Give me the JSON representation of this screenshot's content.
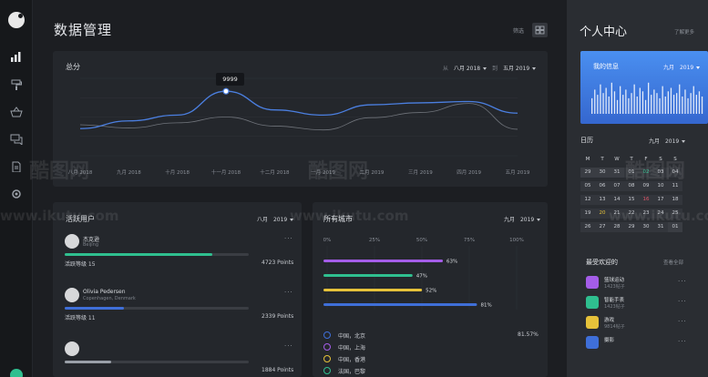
{
  "nav": {
    "icons": [
      "bar-chart-icon",
      "paint-roller-icon",
      "basket-icon",
      "chat-icon",
      "document-icon",
      "settings-icon"
    ]
  },
  "header": {
    "title": "数据管理",
    "filter_label": "筛选"
  },
  "total_score": {
    "title": "总分",
    "from_label": "从",
    "from_month": "八月 2018",
    "to_label": "到",
    "to_month": "五月 2019",
    "tooltip_value": "9999",
    "chart_data": {
      "type": "line",
      "categories": [
        "八月 2018",
        "九月 2018",
        "十月 2018",
        "十一月 2018",
        "十二月 2018",
        "一月 2019",
        "二月 2019",
        "三月 2019",
        "四月 2019",
        "五月 2019"
      ],
      "series": [
        {
          "values": [
            4200,
            5400,
            6300,
            9999,
            7100,
            6300,
            7900,
            8200,
            8400,
            6600
          ],
          "color": "#4b7fe0"
        },
        {
          "values": [
            4800,
            4300,
            5100,
            6000,
            4600,
            4000,
            5900,
            6700,
            8100,
            4100
          ],
          "color": "#6f737a"
        }
      ],
      "grid": true
    }
  },
  "active_users": {
    "title": "活跃用户",
    "month": "八月",
    "year": "2019",
    "users": [
      {
        "name": "杰克逊",
        "location": "Beijing",
        "level_label": "活跃等级 15",
        "points": "4723 Points",
        "progress": 0.8,
        "color": "#2fbf8f"
      },
      {
        "name": "Olivia Pedersen",
        "location": "Copenhagen, Denmark",
        "level_label": "活跃等级 11",
        "points": "2339 Points",
        "progress": 0.32,
        "color": "#3f6fd8"
      },
      {
        "name": "",
        "location": "",
        "level_label": "",
        "points": "1884 Points",
        "progress": 0.25,
        "color": "#9aa0a8"
      }
    ]
  },
  "cities": {
    "title": "所有城市",
    "month": "九月",
    "year": "2019",
    "axis_ticks": [
      "0%",
      "25%",
      "50%",
      "75%",
      "100%"
    ],
    "chart_data": {
      "type": "bar",
      "values": [
        63,
        47,
        52,
        81
      ],
      "value_labels": [
        "63%",
        "47%",
        "52%",
        "81%"
      ],
      "colors": [
        "#a45de8",
        "#2fbf8f",
        "#e6c23a",
        "#3f6fd8"
      ],
      "xlim": [
        0,
        100
      ]
    },
    "list": [
      {
        "name": "中国，北京",
        "value": "81.57%",
        "color": "#3f6fd8"
      },
      {
        "name": "中国，上海",
        "value": "",
        "color": "#a45de8"
      },
      {
        "name": "中国，香港",
        "value": "",
        "color": "#e6c23a"
      },
      {
        "name": "法国，巴黎",
        "value": "",
        "color": "#2fbf8f"
      }
    ]
  },
  "right": {
    "title": "个人中心",
    "link": "了解更多",
    "info_title": "我的信息",
    "info_month": "九月",
    "info_year": "2019",
    "info_bars": [
      0.45,
      0.7,
      0.55,
      0.85,
      0.6,
      0.75,
      0.5,
      0.9,
      0.65,
      0.4,
      0.8,
      0.55,
      0.7,
      0.45,
      0.6,
      0.85,
      0.5,
      0.75,
      0.65,
      0.4,
      0.9,
      0.55,
      0.7,
      0.6,
      0.45,
      0.8,
      0.5,
      0.65,
      0.75,
      0.55,
      0.6,
      0.85,
      0.5,
      0.7,
      0.45,
      0.6,
      0.8,
      0.55,
      0.65,
      0.5
    ],
    "calendar_title": "日历",
    "calendar_month": "九月",
    "calendar_year": "2019",
    "weekdays": [
      "M",
      "T",
      "W",
      "T",
      "F",
      "S",
      "S"
    ],
    "days": [
      [
        "29",
        "30",
        "31",
        "01",
        "02",
        "03",
        "04"
      ],
      [
        "05",
        "06",
        "07",
        "08",
        "09",
        "10",
        "11"
      ],
      [
        "12",
        "13",
        "14",
        "15",
        "16",
        "17",
        "18"
      ],
      [
        "19",
        "20",
        "21",
        "22",
        "23",
        "24",
        "25"
      ],
      [
        "26",
        "27",
        "28",
        "29",
        "30",
        "31",
        "01"
      ]
    ],
    "fav_title": "最受欢迎的",
    "fav_link": "查看全部",
    "favorites": [
      {
        "name": "篮球运动",
        "sub": "1423帖子",
        "color": "#a45de8",
        "icon": "headphones-icon"
      },
      {
        "name": "智能手表",
        "sub": "1423帖子",
        "color": "#2fbf8f",
        "icon": "watch-icon"
      },
      {
        "name": "游戏",
        "sub": "9814帖子",
        "color": "#e6c23a",
        "icon": "gamepad-icon"
      },
      {
        "name": "摄影",
        "sub": "",
        "color": "#3f6fd8",
        "icon": "camera-icon"
      }
    ]
  },
  "watermark": {
    "text1": "酷图网",
    "text2": "www.ikutu.com"
  }
}
